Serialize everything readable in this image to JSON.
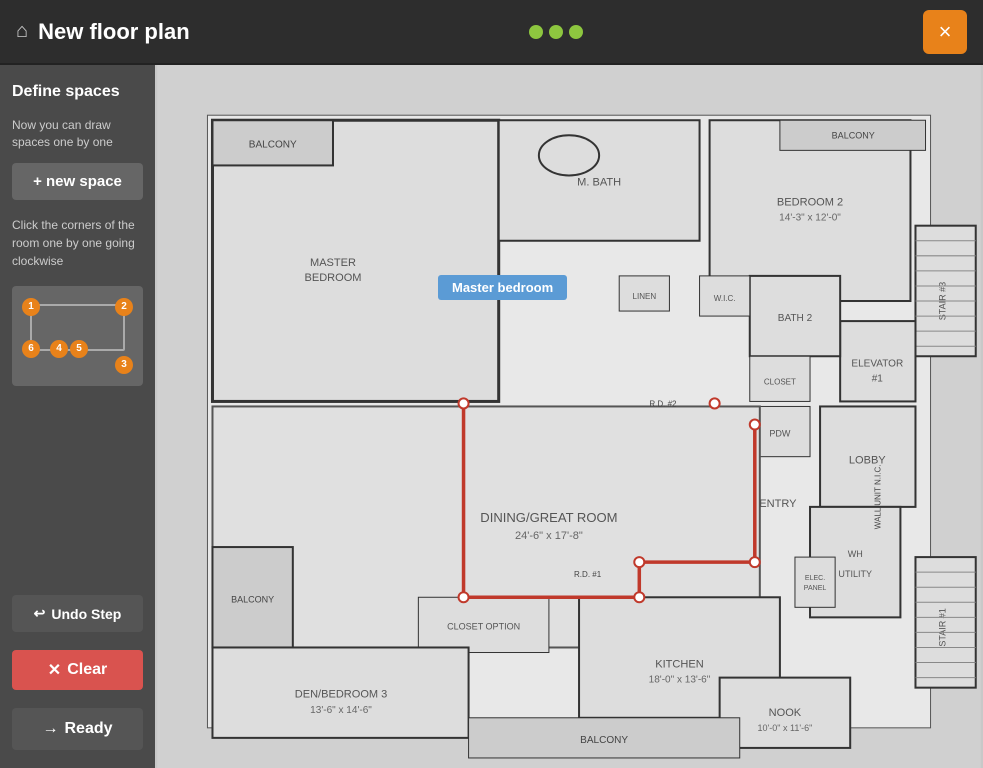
{
  "header": {
    "title": "New floor plan",
    "close_label": "×",
    "dots": [
      "green",
      "green",
      "green"
    ]
  },
  "sidebar": {
    "define_spaces_title": "Define spaces",
    "define_spaces_desc": "Now you can draw spaces one by one",
    "new_space_label": "+ new space",
    "instructions": "Click the corners of the room one by one going clockwise",
    "corners": [
      "1",
      "2",
      "3",
      "4",
      "5",
      "6"
    ],
    "undo_label": "Undo Step",
    "clear_label": "Clear",
    "ready_label": "Ready"
  },
  "floorplan": {
    "master_bedroom_label": "Master bedroom"
  }
}
